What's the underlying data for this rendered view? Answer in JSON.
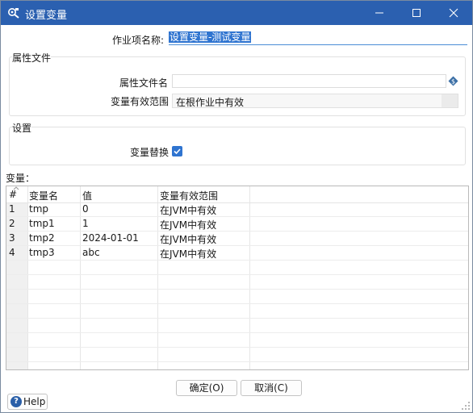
{
  "window": {
    "title": "设置变量",
    "icon": "settings-variable-icon"
  },
  "form": {
    "job_name_label": "作业项名称:",
    "job_name_value": "设置变量-测试变量"
  },
  "properties_group": {
    "title": "属性文件",
    "filename_label": "属性文件名",
    "filename_value": "",
    "scope_label": "变量有效范围",
    "scope_value": "在根作业中有效"
  },
  "settings_group": {
    "title": "设置",
    "replace_label": "变量替换",
    "replace_checked": true
  },
  "variables": {
    "label": "变量：",
    "columns": [
      "#",
      "变量名",
      "值",
      "变量有效范围"
    ],
    "rows": [
      {
        "num": "1",
        "name": "tmp",
        "value": "0",
        "scope": "在JVM中有效"
      },
      {
        "num": "2",
        "name": "tmp1",
        "value": "1",
        "scope": "在JVM中有效"
      },
      {
        "num": "3",
        "name": "tmp2",
        "value": "2024-01-01",
        "scope": "在JVM中有效"
      },
      {
        "num": "4",
        "name": "tmp3",
        "value": "abc",
        "scope": "在JVM中有效"
      }
    ]
  },
  "buttons": {
    "ok": "确定(O)",
    "cancel": "取消(C)",
    "help": "Help"
  },
  "colors": {
    "titlebar": "#2b60b0",
    "accent": "#2f74d0"
  }
}
